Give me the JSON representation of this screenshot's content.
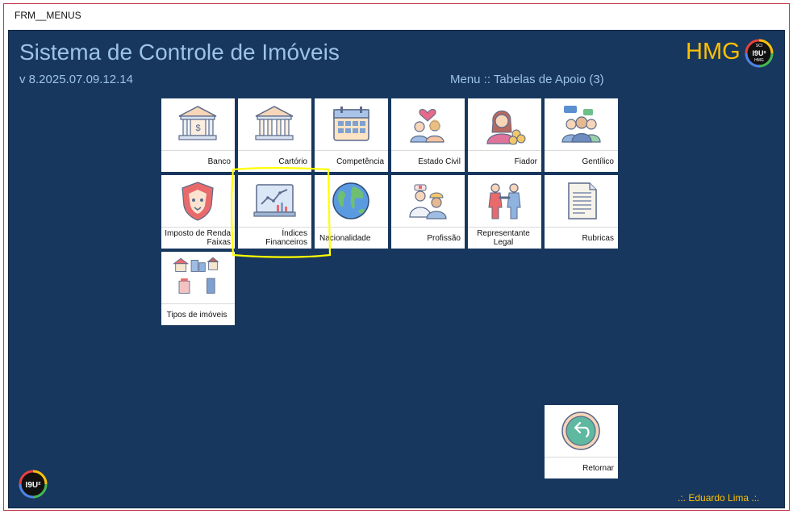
{
  "window": {
    "title": "FRM__MENUS"
  },
  "header": {
    "app_title": "Sistema de Controle de Imóveis",
    "version": "v 8.2025.07.09.12.14",
    "menu_path": "Menu :: Tabelas de Apoio (3)",
    "env_label": "HMG",
    "logo_text": "I9U²",
    "logo_top_small": "SCI",
    "logo_bottom_small": "HMG"
  },
  "tiles": [
    {
      "id": "banco",
      "label": "Banco",
      "icon": "bank-icon"
    },
    {
      "id": "cartorio",
      "label": "Cartório",
      "icon": "registry-building-icon"
    },
    {
      "id": "competencia",
      "label": "Competência",
      "icon": "calendar-icon"
    },
    {
      "id": "estado-civil",
      "label": "Estado Civil",
      "icon": "couple-heart-icon"
    },
    {
      "id": "fiador",
      "label": "Fiador",
      "icon": "guarantor-coins-icon"
    },
    {
      "id": "gentilico",
      "label": "Gentílico",
      "icon": "people-speech-icon"
    },
    {
      "id": "imposto",
      "label": "Imposto de Renda Faixas",
      "icon": "lion-shield-icon"
    },
    {
      "id": "indices",
      "label": "Índices Financeiros",
      "icon": "financial-chart-icon"
    },
    {
      "id": "nacionalidade",
      "label": "Nacionalidade",
      "icon": "globe-icon"
    },
    {
      "id": "profissao",
      "label": "Profissão",
      "icon": "professionals-icon"
    },
    {
      "id": "representante",
      "label": "Representante Legal",
      "icon": "handshake-people-icon"
    },
    {
      "id": "rubricas",
      "label": "Rubricas",
      "icon": "document-list-icon"
    },
    {
      "id": "tipos-imoveis",
      "label": "Tipos de imóveis",
      "icon": "buildings-icon"
    }
  ],
  "retornar": {
    "label": "Retornar",
    "icon": "return-arrow-icon"
  },
  "footer": {
    "user": ".:. Eduardo Lima .:."
  },
  "colors": {
    "background": "#17375e",
    "title_text": "#9dc3e6",
    "accent": "#ffc000",
    "highlight": "#ffff00"
  }
}
